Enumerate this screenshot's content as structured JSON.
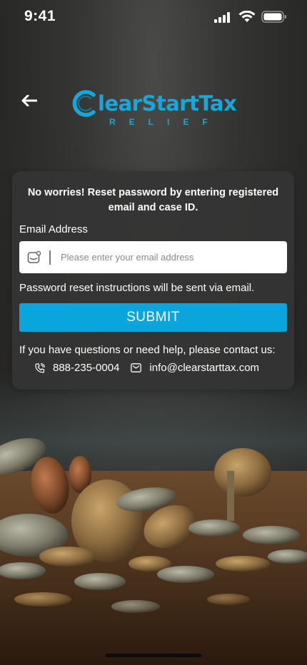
{
  "status_bar": {
    "time": "9:41"
  },
  "header": {
    "back_icon": "arrow-left-icon",
    "logo": {
      "main": "learStartTax",
      "sub": "RELIEF",
      "color": "#1aa7d8"
    }
  },
  "card": {
    "heading": "No worries! Reset password by entering registered email and case ID.",
    "email_label": "Email Address",
    "email_placeholder": "Please enter your email address",
    "email_value": "",
    "helper_text": "Password reset instructions will be sent via email.",
    "submit_label": "SUBMIT",
    "contact_prompt": "If you have questions or need help, please contact us:",
    "phone": "888-235-0004",
    "email": "info@clearstarttax.com"
  },
  "colors": {
    "accent": "#0aa5dc",
    "card_bg": "#343434"
  }
}
